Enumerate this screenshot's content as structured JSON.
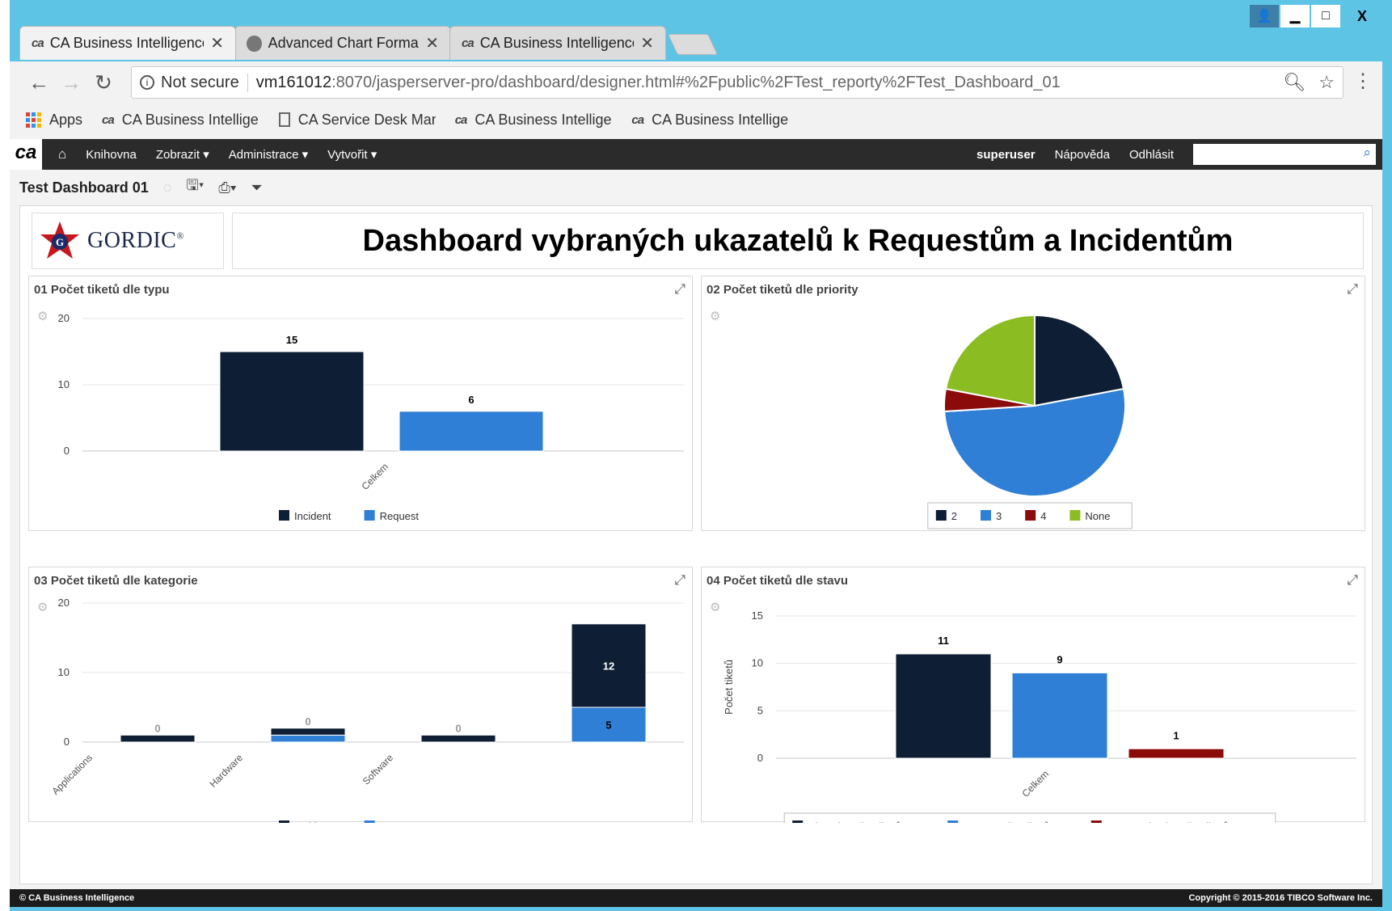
{
  "window": {
    "controls": {
      "user": "👤",
      "minimize": "▁",
      "maximize": "□",
      "close": "X"
    }
  },
  "tabs": [
    {
      "label": "CA Business Intelligence",
      "icon": "ca-logo"
    },
    {
      "label": "Advanced Chart Formatti",
      "icon": "jaspersoft-icon"
    },
    {
      "label": "CA Business Intelligence",
      "icon": "ca-logo"
    }
  ],
  "tab_close": "✕",
  "address": {
    "security": "Not secure",
    "host": "vm161012",
    "url": ":8070/jasperserver-pro/dashboard/designer.html#%2Fpublic%2FTest_reporty%2FTest_Dashboard_01"
  },
  "bookmarks": [
    {
      "label": "Apps"
    },
    {
      "label": "CA Business Intelligen"
    },
    {
      "label": "CA Service Desk Man"
    },
    {
      "label": "CA Business Intelligen"
    },
    {
      "label": "CA Business Intelligen"
    }
  ],
  "jsnav": {
    "logo": "ca",
    "items": [
      "Knihovna",
      "Zobrazit ▾",
      "Administrace ▾",
      "Vytvořit ▾"
    ],
    "user": "superuser",
    "help": "Nápověda",
    "logout": "Odhlásit"
  },
  "dashboard": {
    "name": "Test Dashboard 01",
    "brand": "GORDIC",
    "brand_mark": "®",
    "title": "Dashboard vybraných ukazatelů k Requestům a Incidentům"
  },
  "colors": {
    "navy": "#0d1e35",
    "blue": "#2f7fd6",
    "darkred": "#8b0a0a",
    "green": "#8bbd22"
  },
  "panels": [
    {
      "title": "01 Počet tiketů dle typu"
    },
    {
      "title": "02 Počet tiketů dle priority"
    },
    {
      "title": "03 Počet tiketů dle kategorie"
    },
    {
      "title": "04 Počet tiketů dle stavu"
    }
  ],
  "chart_data": [
    {
      "type": "bar",
      "categories": [
        "Celkem"
      ],
      "series": [
        {
          "name": "Incident",
          "values": [
            15
          ]
        },
        {
          "name": "Request",
          "values": [
            6
          ]
        }
      ],
      "yticks": [
        0,
        10,
        20
      ],
      "ylim": [
        0,
        20
      ],
      "legend": "bottom"
    },
    {
      "type": "pie",
      "labels": [
        "2",
        "3",
        "4",
        "None"
      ],
      "values": [
        22,
        52,
        4,
        22
      ],
      "legend": "bottom"
    },
    {
      "type": "bar",
      "stacked": true,
      "categories": [
        "Applications",
        "Hardware",
        "Software",
        ""
      ],
      "series": [
        {
          "name": "Incident",
          "values": [
            1,
            1,
            1,
            12
          ]
        },
        {
          "name": "Request",
          "values": [
            0,
            1,
            0,
            5
          ]
        }
      ],
      "zero_labels": [
        "0",
        "0",
        "0"
      ],
      "data_labels": [
        "12",
        "5"
      ],
      "yticks": [
        0,
        10,
        20
      ],
      "ylim": [
        0,
        20
      ],
      "legend": "bottom"
    },
    {
      "type": "bar",
      "categories": [
        "Celkem"
      ],
      "series": [
        {
          "name": "Closed, Počet tiketů",
          "values": [
            11
          ]
        },
        {
          "name": "Open, Počet tiketů",
          "values": [
            9
          ]
        },
        {
          "name": "SA-Resolved, Počet tiketů",
          "values": [
            1
          ]
        }
      ],
      "ylabel": "Počet tiketů",
      "yticks": [
        0,
        5,
        10,
        15
      ],
      "ylim": [
        0,
        15
      ],
      "legend": "bottom"
    }
  ],
  "footer": {
    "left": "© CA Business Intelligence",
    "right": "Copyright © 2015-2016 TIBCO Software Inc."
  }
}
